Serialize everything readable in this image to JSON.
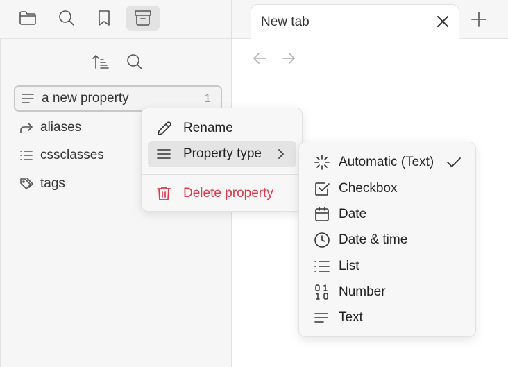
{
  "left_toolbar": {
    "buttons": [
      {
        "icon": "folder-icon",
        "active": false
      },
      {
        "icon": "search-icon",
        "active": false
      },
      {
        "icon": "bookmark-icon",
        "active": false
      },
      {
        "icon": "archive-icon",
        "active": true
      }
    ]
  },
  "sidebar": {
    "tools": [
      {
        "icon": "sort-icon"
      },
      {
        "icon": "search-icon"
      }
    ],
    "properties": [
      {
        "label": "a new property",
        "icon": "text-lines-icon",
        "count": "1",
        "selected": true
      },
      {
        "label": "aliases",
        "icon": "forward-arrow-icon"
      },
      {
        "label": "cssclasses",
        "icon": "list-icon"
      },
      {
        "label": "tags",
        "icon": "tags-icon"
      }
    ]
  },
  "tabs": {
    "active_title": "New tab",
    "close_icon": "close-icon",
    "new_tab_icon": "plus-icon"
  },
  "navigation": {
    "back_icon": "arrow-left-icon",
    "forward_icon": "arrow-right-icon"
  },
  "context_menu": {
    "rename": "Rename",
    "property_type": "Property type",
    "delete": "Delete property",
    "danger_color": "#e0384a"
  },
  "property_type_menu": {
    "items": [
      {
        "label": "Automatic (Text)",
        "icon": "sparkle-icon",
        "checked": true
      },
      {
        "label": "Checkbox",
        "icon": "checkbox-icon"
      },
      {
        "label": "Date",
        "icon": "calendar-icon"
      },
      {
        "label": "Date & time",
        "icon": "clock-icon"
      },
      {
        "label": "List",
        "icon": "list-icon"
      },
      {
        "label": "Number",
        "icon": "binary-icon"
      },
      {
        "label": "Text",
        "icon": "text-lines-icon"
      }
    ]
  }
}
